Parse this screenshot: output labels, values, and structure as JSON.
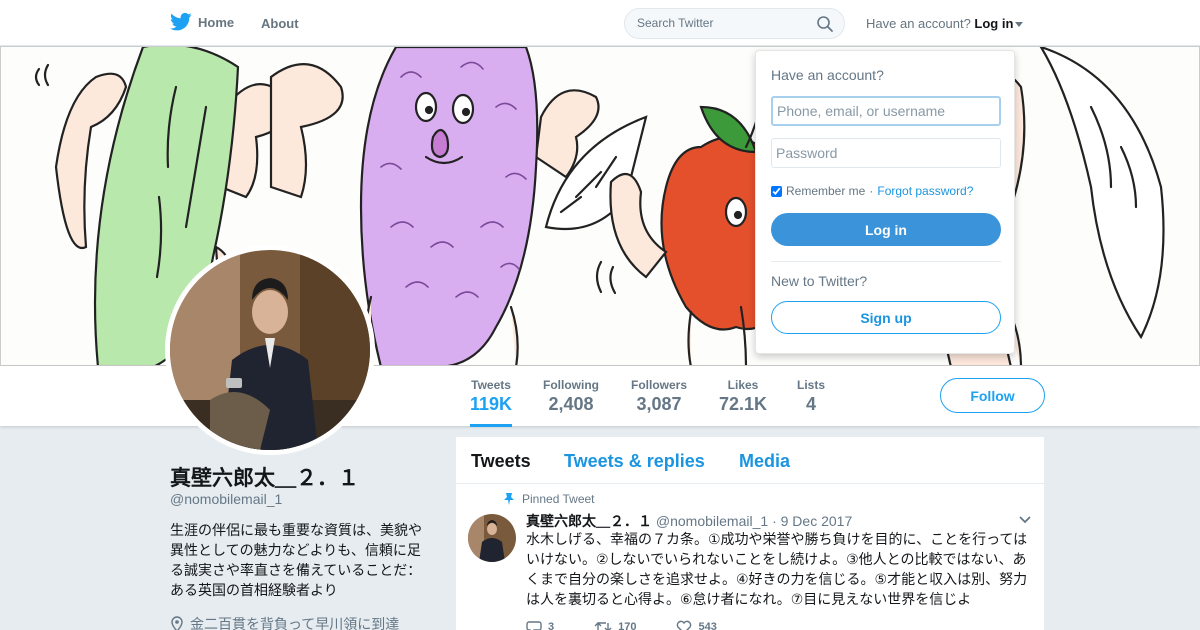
{
  "nav": {
    "home_label": "Home",
    "about_label": "About",
    "search_placeholder": "Search Twitter",
    "account_prompt": "Have an account?",
    "login_label": "Log in"
  },
  "stats": [
    {
      "label": "Tweets",
      "value": "119K"
    },
    {
      "label": "Following",
      "value": "2,408"
    },
    {
      "label": "Followers",
      "value": "3,087"
    },
    {
      "label": "Likes",
      "value": "72.1K"
    },
    {
      "label": "Lists",
      "value": "4"
    }
  ],
  "follow_label": "Follow",
  "profile": {
    "name": "真壁六郎太＿２．１",
    "handle": "@nomobilemail_1",
    "bio": "生涯の伴侶に最も重要な資質は、美貌や異性としての魅力などよりも、信頼に足る誠実さや率直さを備えていることだ：ある英国の首相経験者より",
    "location": "金二百貫を背負って早川領に到達"
  },
  "tabs": [
    "Tweets",
    "Tweets & replies",
    "Media"
  ],
  "tweet": {
    "pinned_label": "Pinned Tweet",
    "name": "真壁六郎太＿２．１",
    "handle": "@nomobilemail_1",
    "date": "9 Dec 2017",
    "text": "水木しげる、幸福の７カ条。①成功や栄誉や勝ち負けを目的に、ことを行ってはいけない。②しないでいられないことをし続けよ。③他人との比較ではない、あくまで自分の楽しさを追求せよ。④好きの力を信じる。⑤才能と収入は別、努力は人を裏切ると心得よ。⑥怠け者になれ。⑦目に見えない世界を信じよ",
    "replies": "3",
    "retweets": "170",
    "likes": "543"
  },
  "login_box": {
    "heading": "Have an account?",
    "username_placeholder": "Phone, email, or username",
    "password_placeholder": "Password",
    "remember_label": "Remember me",
    "separator": "·",
    "forgot_label": "Forgot password?",
    "login_button": "Log in",
    "new_prompt": "New to Twitter?",
    "signup_button": "Sign up"
  },
  "colors": {
    "accent": "#1da1f2",
    "link": "#1b95e0",
    "login_button": "#3b94d9",
    "page_bg": "#e6ecf0"
  }
}
